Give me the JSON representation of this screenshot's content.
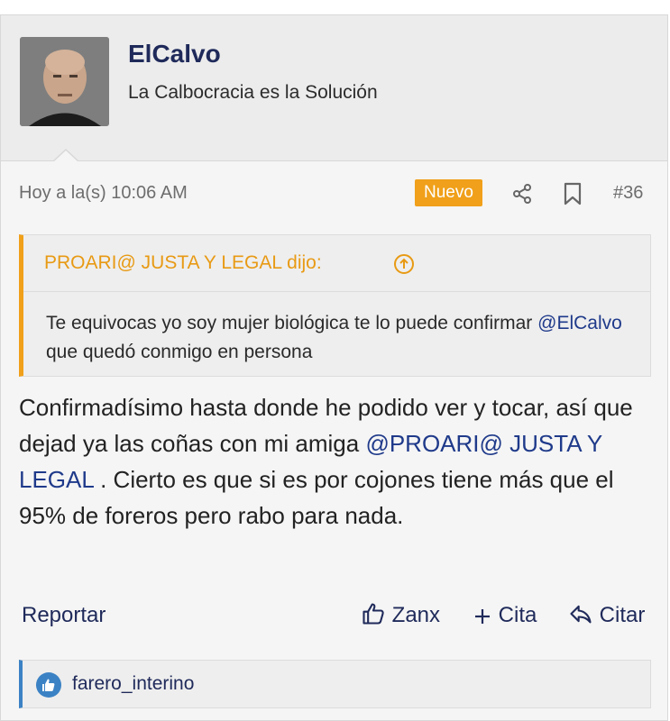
{
  "user": {
    "name": "ElCalvo",
    "title": "La Calbocracia es la Solución"
  },
  "meta": {
    "timestamp": "Hoy a la(s) 10:06 AM",
    "badge": "Nuevo",
    "post_number": "#36"
  },
  "quote": {
    "author": "PROARI@ JUSTA Y LEGAL dijo:",
    "text_before": "Te equivocas yo soy mujer biológica te lo puede confirmar ",
    "mention": "@ElCalvo",
    "text_after": " que quedó conmigo en persona"
  },
  "content": {
    "text_before": "Confirmadísimo hasta donde he podido ver y tocar, así que dejad ya las coñas con mi amiga ",
    "mention": "@PROARI@ JUSTA Y LEGAL",
    "text_after": " . Cierto es que si es por cojones tiene más que el 95% de foreros pero rabo para nada."
  },
  "actions": {
    "report": "Reportar",
    "zanx": "Zanx",
    "cita": "Cita",
    "citar": "Citar"
  },
  "reactions": {
    "users": "farero_interino"
  },
  "colors": {
    "accent": "#f0a01a",
    "link": "#1f2a5a",
    "like": "#3b82c4"
  }
}
